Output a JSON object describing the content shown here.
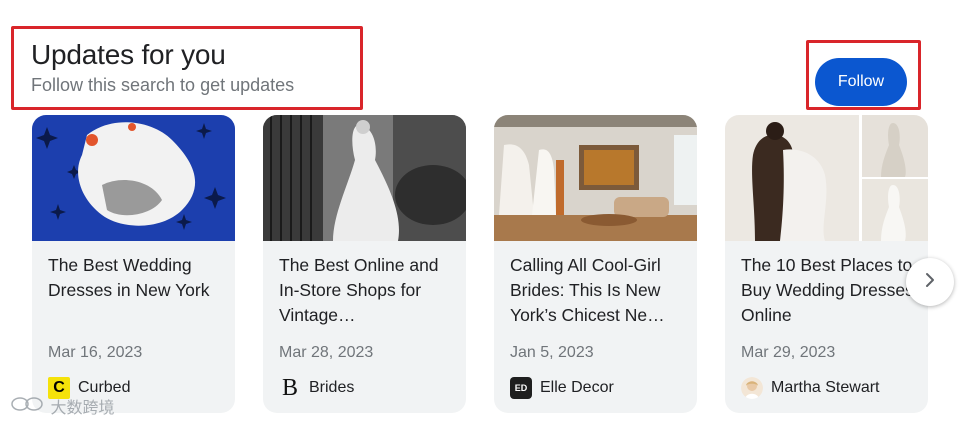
{
  "header": {
    "title": "Updates for you",
    "subtitle": "Follow this search to get updates",
    "follow_label": "Follow"
  },
  "cards": [
    {
      "headline": "The Best Wedding Dresses in New York",
      "date": "Mar 16, 2023",
      "source": "Curbed",
      "source_logo_text": "C"
    },
    {
      "headline": "The Best Online and In-Store Shops for Vintage…",
      "date": "Mar 28, 2023",
      "source": "Brides",
      "source_logo_text": "B"
    },
    {
      "headline": "Calling All Cool-Girl Brides: This Is New York’s Chicest Ne…",
      "date": "Jan 5, 2023",
      "source": "Elle Decor",
      "source_logo_text": "ED"
    },
    {
      "headline": "The 10 Best Places to Buy Wedding Dresses Online",
      "date": "Mar 29, 2023",
      "source": "Martha Stewart"
    }
  ],
  "watermark": "大数跨境",
  "icons": {
    "next": "chevron-right-icon"
  },
  "colors": {
    "follow_button": "#0b57d0",
    "annotation_red": "#d9252a",
    "card_bg": "#f1f3f4"
  }
}
